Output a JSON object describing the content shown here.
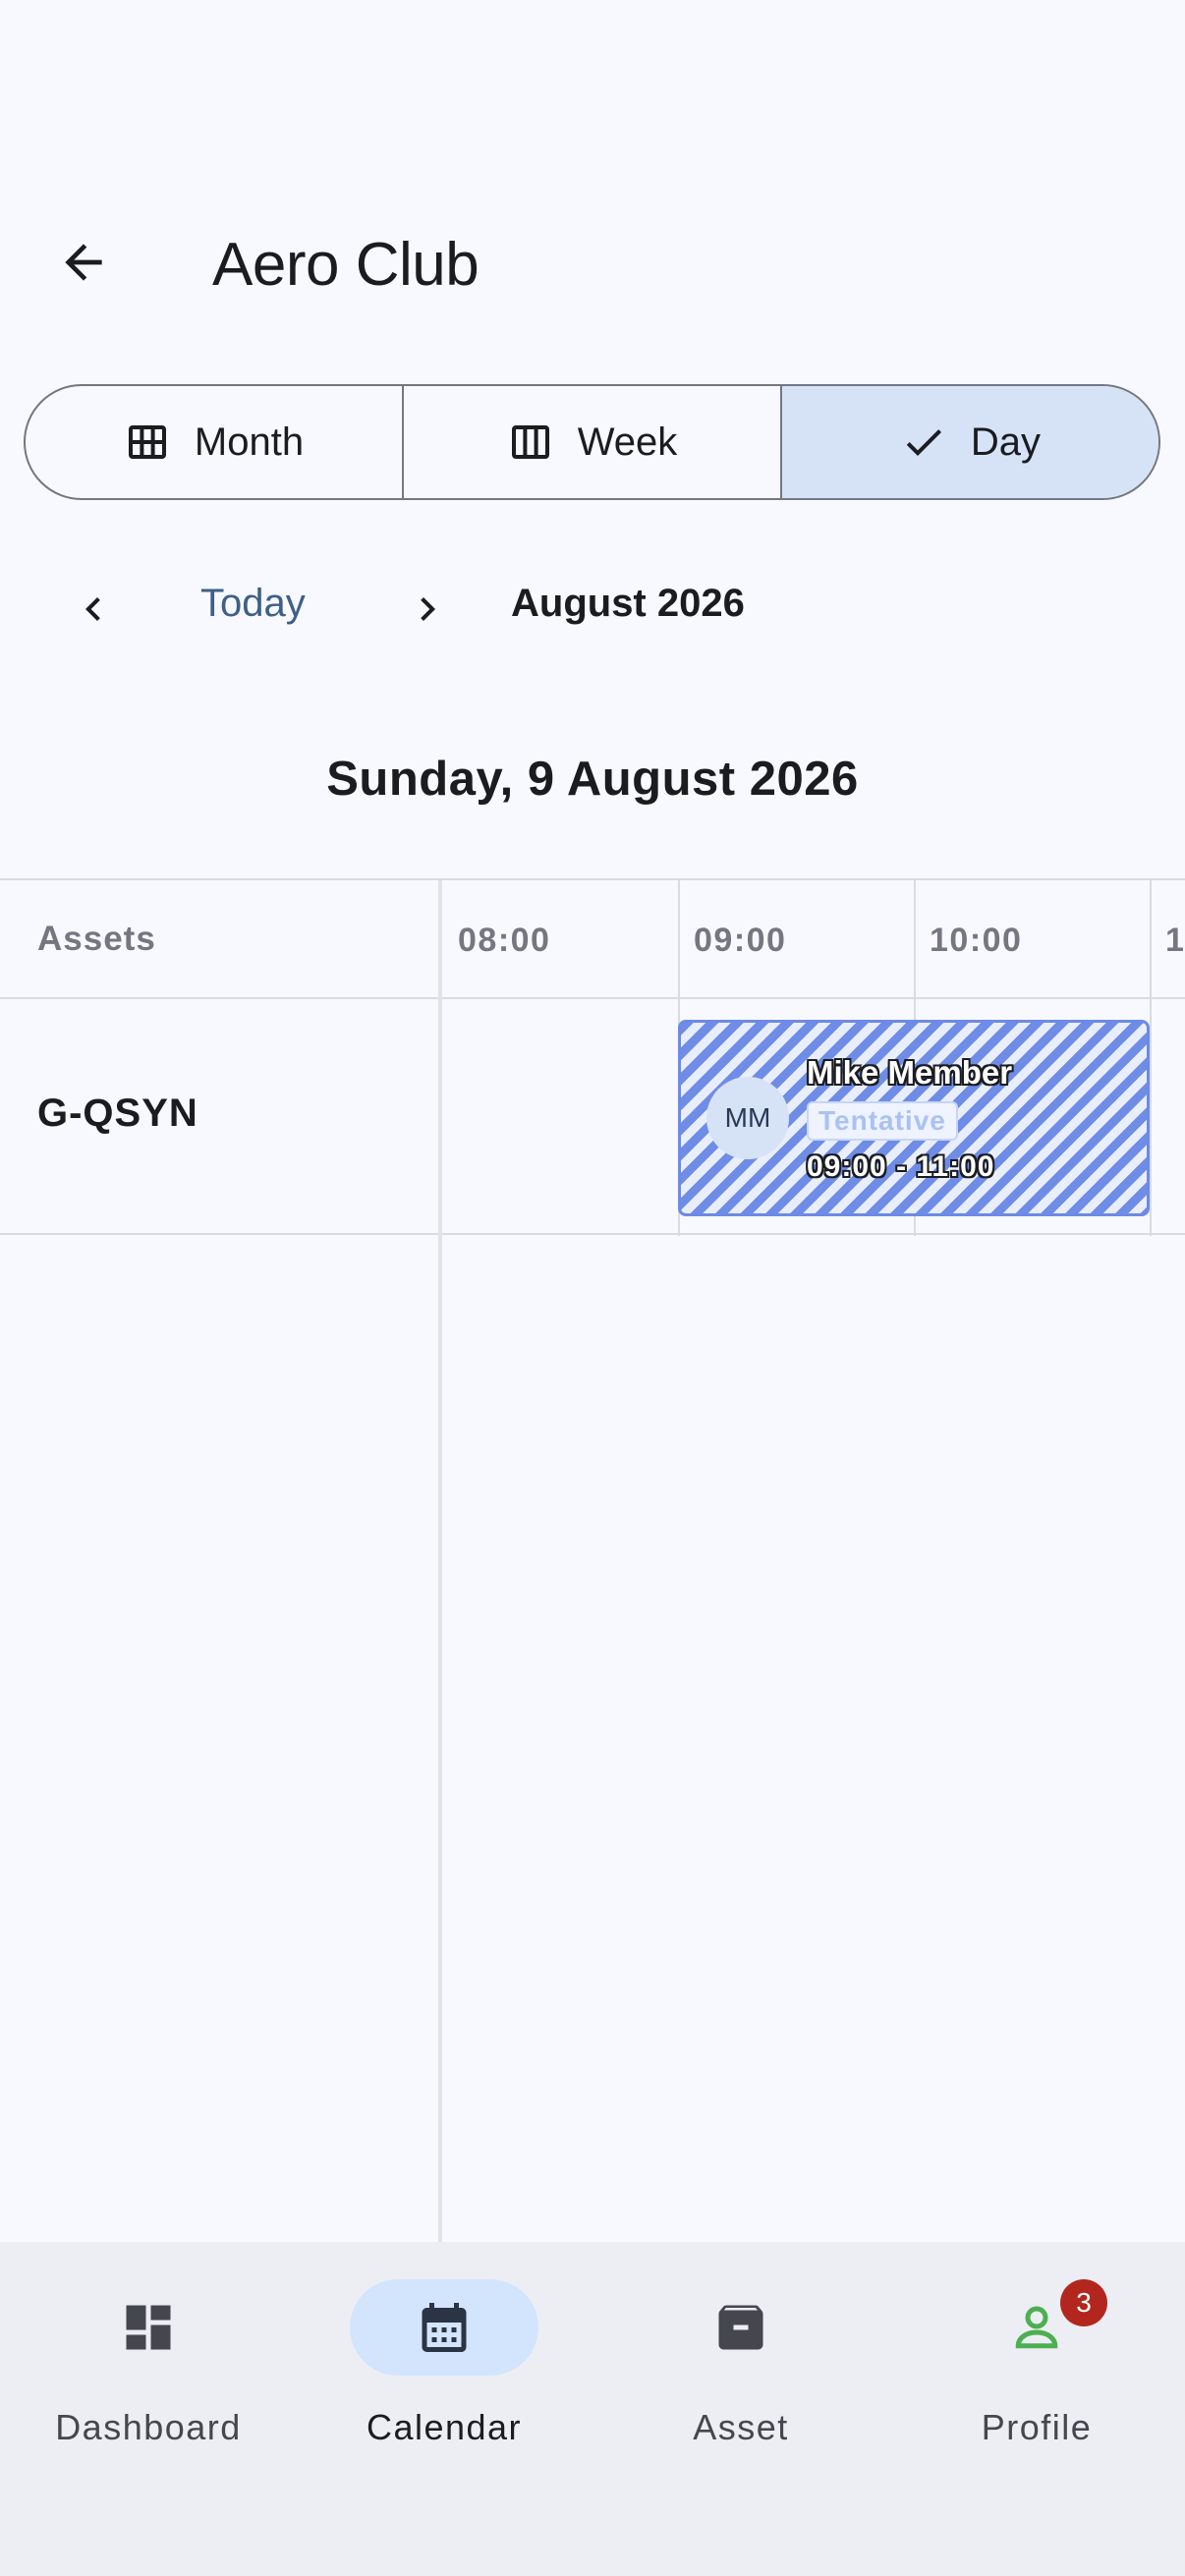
{
  "app_bar": {
    "title": "Aero Club",
    "back_icon": "arrow-back-icon"
  },
  "view_switcher": {
    "options": [
      {
        "label": "Month",
        "icon": "grid-month-icon",
        "selected": false
      },
      {
        "label": "Week",
        "icon": "week-columns-icon",
        "selected": false
      },
      {
        "label": "Day",
        "icon": "check-icon",
        "selected": true
      }
    ]
  },
  "date_nav": {
    "prev_icon": "chevron-left-icon",
    "today_label": "Today",
    "next_icon": "chevron-right-icon",
    "month_label": "August 2026"
  },
  "day_header": "Sunday, 9 August 2026",
  "timeline": {
    "assets_header": "Assets",
    "hours": [
      "08:00",
      "09:00",
      "10:00",
      "1"
    ],
    "assets": [
      {
        "name": "G-QSYN",
        "bookings": [
          {
            "initials": "MM",
            "member": "Mike Member",
            "status": "Tentative",
            "time_range": "09:00 - 11:00",
            "color": "#6f8ce6"
          }
        ]
      }
    ]
  },
  "bottom_nav": {
    "items": [
      {
        "label": "Dashboard",
        "icon": "dashboard-icon",
        "active": false
      },
      {
        "label": "Calendar",
        "icon": "calendar-icon",
        "active": true
      },
      {
        "label": "Asset",
        "icon": "archive-box-icon",
        "active": false
      },
      {
        "label": "Profile",
        "icon": "person-icon",
        "active": false,
        "badge": "3"
      }
    ]
  },
  "colors": {
    "accent": "#3f5f86",
    "selected_segment": "#d6e3f7",
    "booking_stripe": "#6f8ce6",
    "badge": "#b3261e",
    "profile_icon": "#4caf50"
  }
}
